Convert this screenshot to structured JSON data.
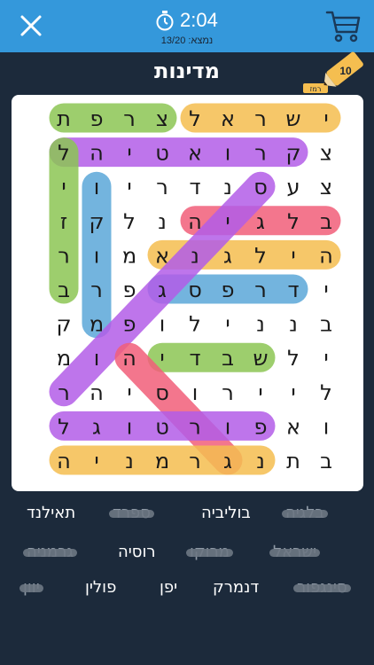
{
  "header": {
    "timer": "2:04",
    "found_label": "נמצא: 13/20",
    "colors": {
      "bar": "#3498db",
      "background": "#1c2a3b"
    },
    "icons": {
      "close": "close-icon",
      "cart": "cart-icon",
      "timer": "stopwatch-icon"
    }
  },
  "title": "מדינות",
  "hint": {
    "count": "10",
    "label": "רמז",
    "icon": "pencil-icon"
  },
  "grid": {
    "rows": [
      [
        "י",
        "ש",
        "ר",
        "א",
        "ל",
        "צ",
        "ר",
        "פ",
        "ת"
      ],
      [
        "צ",
        "ק",
        "ר",
        "ו",
        "א",
        "ט",
        "י",
        "ה",
        "ל"
      ],
      [
        "צ",
        "ע",
        "ס",
        "נ",
        "ד",
        "ר",
        "י",
        "ו",
        "י"
      ],
      [
        "ב",
        "ל",
        "ג",
        "י",
        "ה",
        "נ",
        "ל",
        "ק",
        "ז"
      ],
      [
        "ה",
        "י",
        "ל",
        "ג",
        "נ",
        "א",
        "מ",
        "ו",
        "ר"
      ],
      [
        "י",
        "ד",
        "ר",
        "פ",
        "ס",
        "ג",
        "פ",
        "ר",
        "ב"
      ],
      [
        "ב",
        "נ",
        "נ",
        "י",
        "ל",
        "ו",
        "פ",
        "מ",
        "ק"
      ],
      [
        "י",
        "ל",
        "ש",
        "ב",
        "ד",
        "י",
        "ה",
        "ו",
        "מ"
      ],
      [
        "ל",
        "י",
        "י",
        "ר",
        "ו",
        "ס",
        "י",
        "ה",
        "ר"
      ],
      [
        "ו",
        "א",
        "פ",
        "ו",
        "ר",
        "ט",
        "ו",
        "ג",
        "ל"
      ],
      [
        "ב",
        "ת",
        "נ",
        "ג",
        "ר",
        "מ",
        "נ",
        "י",
        "ה"
      ]
    ],
    "highlight_colors": [
      "#f5be50",
      "#8cc654",
      "#b35de8",
      "#f25f7a",
      "#5ba8d9"
    ]
  },
  "words": [
    {
      "text": "בלגיה",
      "found": true
    },
    {
      "text": "בוליביה",
      "found": false
    },
    {
      "text": "ספרד",
      "found": true
    },
    {
      "text": "תאילנד",
      "found": false
    },
    {
      "text": "ישראל",
      "found": true
    },
    {
      "text": "מרוקו",
      "found": true
    },
    {
      "text": "רוסיה",
      "found": false
    },
    {
      "text": "גרמניה",
      "found": true
    },
    {
      "text": "סינגפור",
      "found": true
    },
    {
      "text": "דנמרק",
      "found": false
    },
    {
      "text": "יפן",
      "found": false
    },
    {
      "text": "פולין",
      "found": false
    },
    {
      "text": "יוון",
      "found": true
    }
  ]
}
